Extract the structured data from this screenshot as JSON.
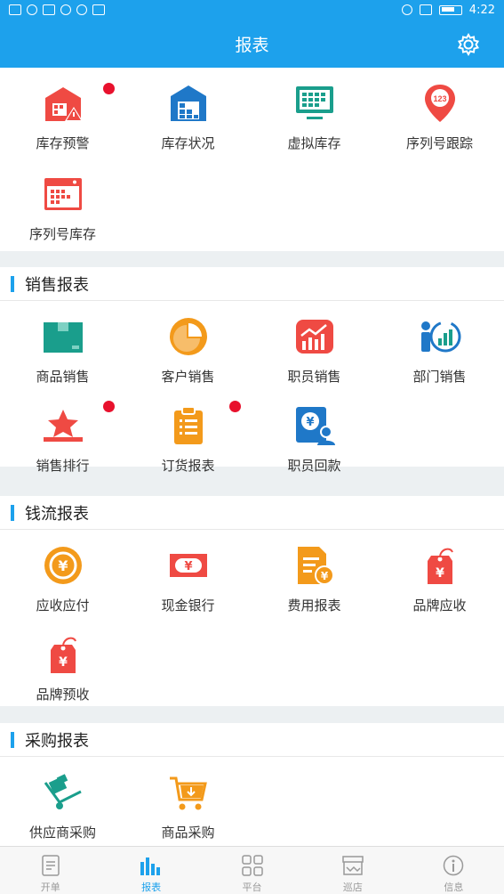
{
  "status_bar": {
    "time": "4:22"
  },
  "header": {
    "title": "报表"
  },
  "inventory": {
    "items": [
      {
        "label": "库存预警",
        "icon": "warehouse-warning-icon",
        "badge": true
      },
      {
        "label": "库存状况",
        "icon": "warehouse-status-icon",
        "badge": false
      },
      {
        "label": "虚拟库存",
        "icon": "monitor-grid-icon",
        "badge": false
      },
      {
        "label": "序列号跟踪",
        "icon": "location-pin-icon",
        "badge": false
      },
      {
        "label": "序列号库存",
        "icon": "browser-grid-icon",
        "badge": false
      }
    ]
  },
  "sales": {
    "title": "销售报表",
    "items": [
      {
        "label": "商品销售",
        "icon": "box-icon",
        "badge": false
      },
      {
        "label": "客户销售",
        "icon": "pie-chart-icon",
        "badge": false
      },
      {
        "label": "职员销售",
        "icon": "growth-chart-icon",
        "badge": false
      },
      {
        "label": "部门销售",
        "icon": "department-chart-icon",
        "badge": false
      },
      {
        "label": "销售排行",
        "icon": "star-podium-icon",
        "badge": true
      },
      {
        "label": "订货报表",
        "icon": "clipboard-icon",
        "badge": true
      },
      {
        "label": "职员回款",
        "icon": "staff-payment-icon",
        "badge": false
      }
    ]
  },
  "cashflow": {
    "title": "钱流报表",
    "items": [
      {
        "label": "应收应付",
        "icon": "yen-coin-icon",
        "badge": false
      },
      {
        "label": "现金银行",
        "icon": "banknote-icon",
        "badge": false
      },
      {
        "label": "费用报表",
        "icon": "expense-doc-icon",
        "badge": false
      },
      {
        "label": "品牌应收",
        "icon": "yen-tag-icon",
        "badge": false
      },
      {
        "label": "品牌预收",
        "icon": "yen-tag-icon",
        "badge": false
      }
    ]
  },
  "purchase": {
    "title": "采购报表",
    "items": [
      {
        "label": "供应商采购",
        "icon": "handtruck-icon",
        "badge": false
      },
      {
        "label": "商品采购",
        "icon": "cart-icon",
        "badge": false
      }
    ]
  },
  "tabbar": {
    "tabs": [
      {
        "label": "开单",
        "icon": "document-icon",
        "active": false
      },
      {
        "label": "报表",
        "icon": "bar-chart-icon",
        "active": true
      },
      {
        "label": "平台",
        "icon": "grid-icon",
        "active": false
      },
      {
        "label": "巡店",
        "icon": "store-icon",
        "active": false
      },
      {
        "label": "信息",
        "icon": "info-icon",
        "active": false
      }
    ]
  },
  "colors": {
    "primary": "#1da1ec",
    "badge": "#e8112d",
    "orange": "#f39a1b",
    "red": "#ef4a43",
    "teal": "#1a9e8c",
    "blue": "#1f78c8"
  }
}
